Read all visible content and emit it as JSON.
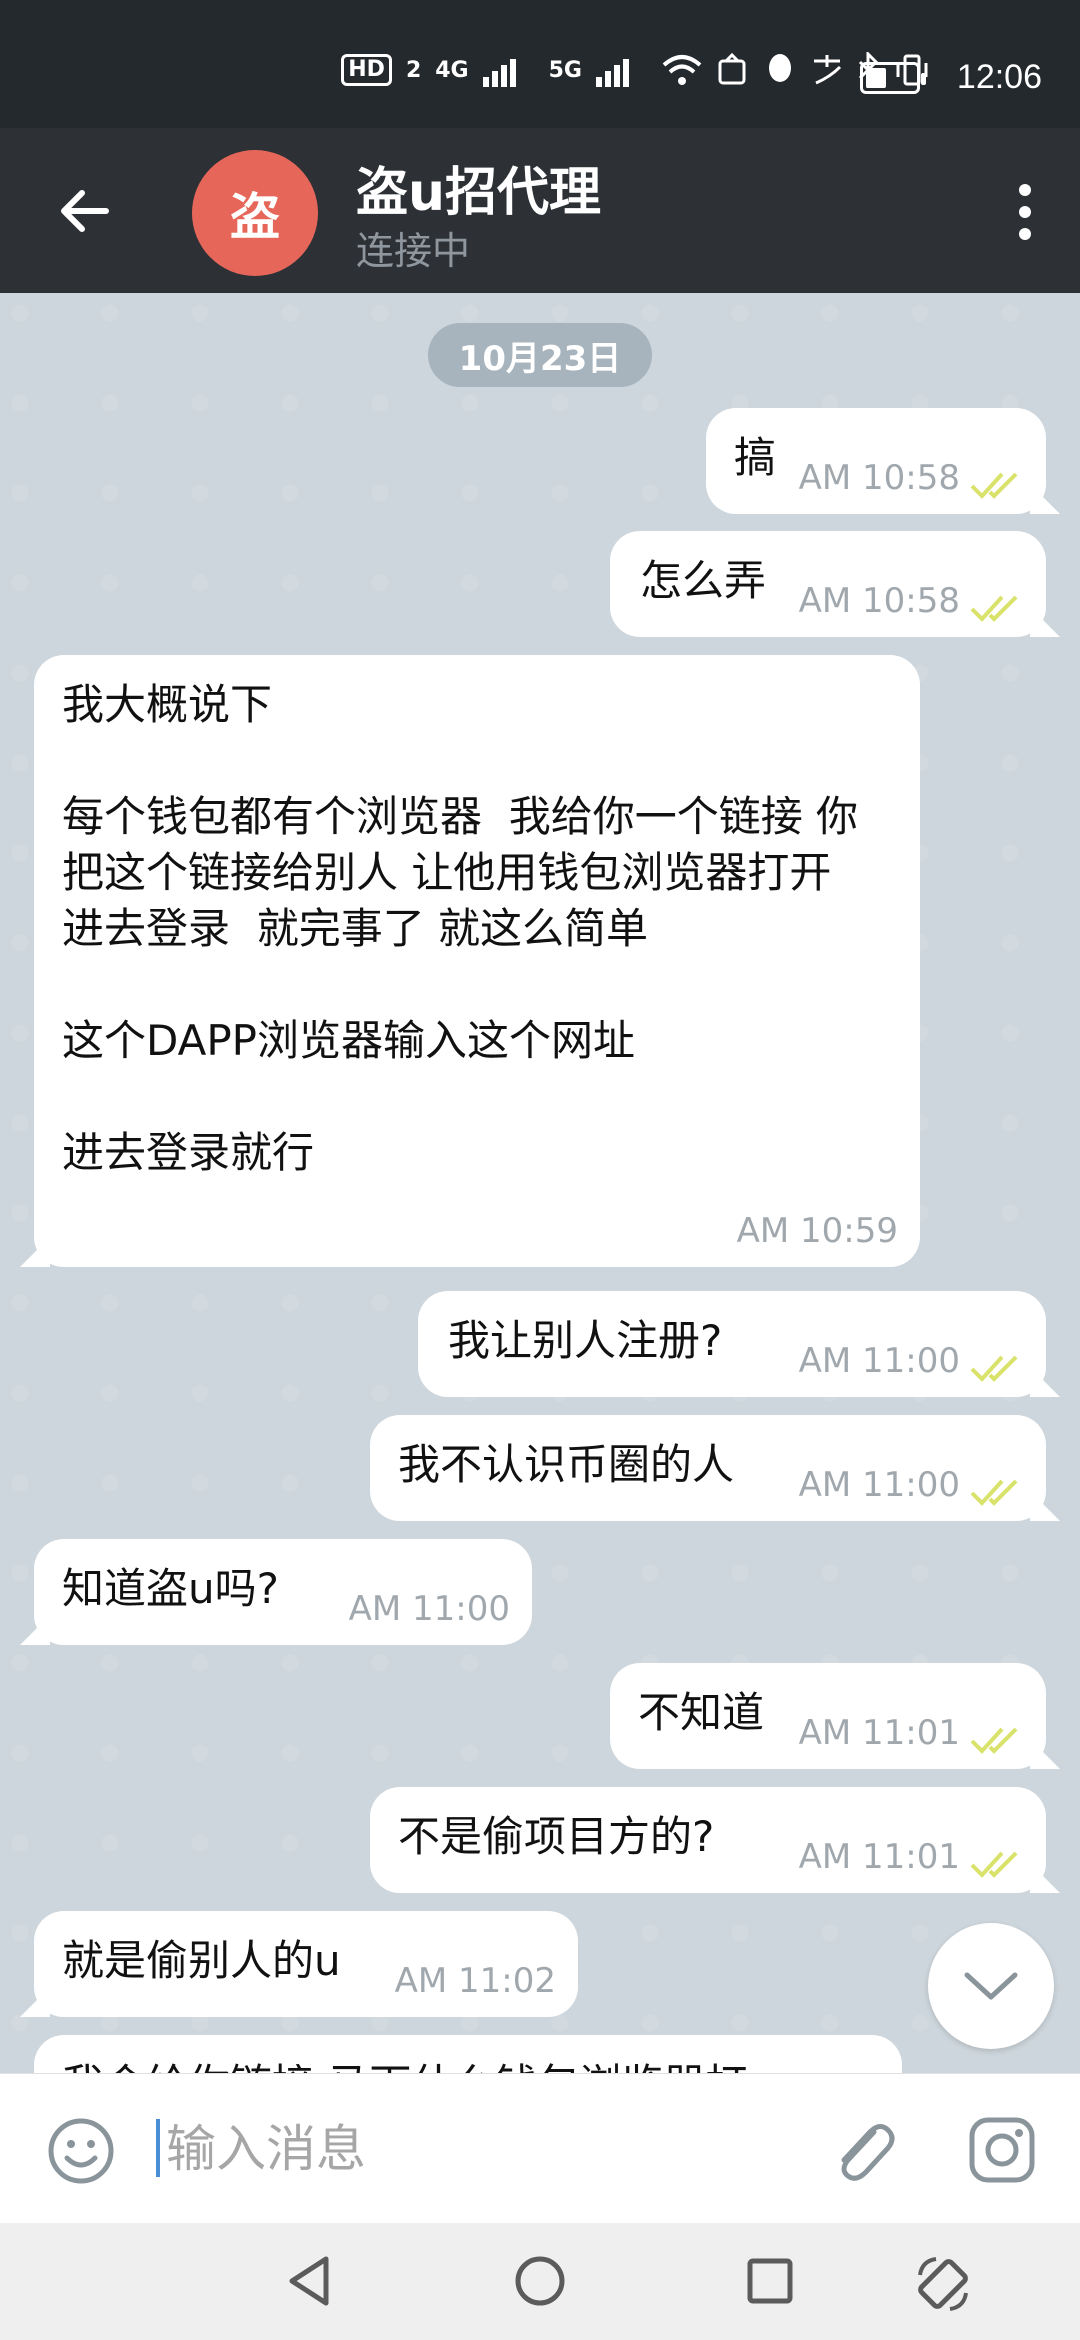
{
  "status_bar": {
    "hd_label": "HD",
    "sim2_label": "2",
    "net1_label": "4G",
    "net2_label": "5G",
    "time": "12:06"
  },
  "header": {
    "avatar_text": "盗",
    "title": "盗u招代理",
    "status": "连接中"
  },
  "date_label": "10月23日",
  "messages": [
    {
      "dir": "out",
      "text": "搞",
      "time": "AM 10:58"
    },
    {
      "dir": "out",
      "text": "怎么弄",
      "time": "AM 10:58"
    },
    {
      "dir": "in",
      "text": "我大概说下\n\n每个钱包都有个浏览器  我给你一个链接 你把这个链接给别人 让他用钱包浏览器打开  进去登录  就完事了 就这么简单\n\n这个DAPP浏览器输入这个网址\n\n进去登录就行",
      "time": "AM 10:59"
    },
    {
      "dir": "out",
      "text": "我让别人注册?",
      "time": "AM 11:00"
    },
    {
      "dir": "out",
      "text": "我不认识币圈的人",
      "time": "AM 11:00"
    },
    {
      "dir": "in",
      "text": "知道盗u吗?",
      "time": "AM 11:00"
    },
    {
      "dir": "out",
      "text": "不知道",
      "time": "AM 11:01"
    },
    {
      "dir": "out",
      "text": "不是偷项目方的?",
      "time": "AM 11:01"
    },
    {
      "dir": "in",
      "text": "就是偷别人的u",
      "time": "AM 11:02"
    },
    {
      "dir": "in",
      "text": "我会给你链接  马下什么钱包浏览器打",
      "time": ""
    }
  ],
  "input": {
    "placeholder": "输入消息"
  },
  "colors": {
    "header_bg": "#2d3136",
    "avatar_bg": "#e6675a",
    "chat_bg": "#cdd6dc",
    "tick_color": "#d9e26a"
  }
}
